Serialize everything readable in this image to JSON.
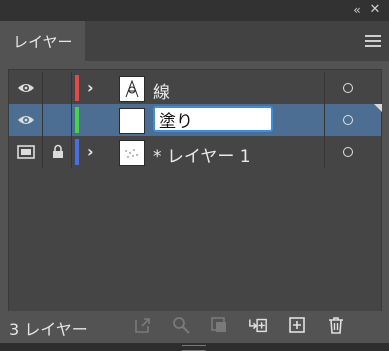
{
  "window": {
    "collapse_icon": "double-chevron-left-icon",
    "close_icon": "close-icon"
  },
  "tab": {
    "label": "レイヤー"
  },
  "menu_icon": "hamburger-menu-icon",
  "layers": [
    {
      "name": "線",
      "visible": true,
      "locked": false,
      "color": "#e24a4a",
      "expandable": true
    },
    {
      "name": "塗り",
      "visible": true,
      "locked": false,
      "color": "#4ad14a",
      "expandable": false,
      "editing": true
    },
    {
      "name": "* レイヤー 1",
      "visible": false,
      "template": true,
      "locked": true,
      "color": "#4a6ee2",
      "expandable": true
    }
  ],
  "footer": {
    "layer_count": "3 レイヤー",
    "tools": [
      "export-icon",
      "search-icon",
      "clipping-mask-icon",
      "new-sublayer-icon",
      "new-layer-icon",
      "trash-icon"
    ]
  }
}
